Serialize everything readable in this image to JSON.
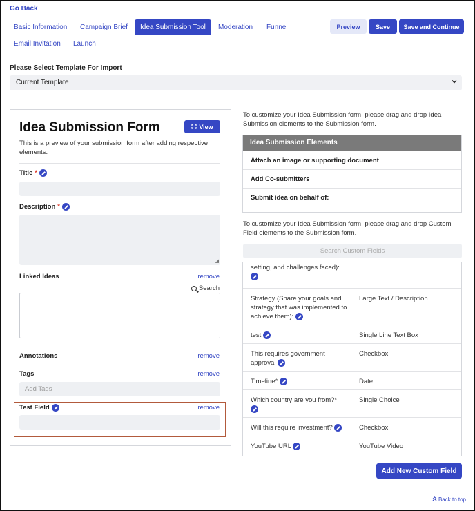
{
  "nav": {
    "go_back": "Go Back",
    "tabs": [
      {
        "label": "Basic Information"
      },
      {
        "label": "Campaign Brief"
      },
      {
        "label": "Idea Submission Tool"
      },
      {
        "label": "Moderation"
      },
      {
        "label": "Funnel"
      },
      {
        "label": "Email Invitation"
      },
      {
        "label": "Launch"
      }
    ],
    "active_tab": "Idea Submission Tool"
  },
  "actions": {
    "preview": "Preview",
    "save": "Save",
    "save_continue": "Save and Continue"
  },
  "template": {
    "label": "Please Select Template For Import",
    "selected": "Current Template"
  },
  "form": {
    "title": "Idea Submission Form",
    "view_label": "View",
    "description": "This is a preview of your submission form after adding respective elements.",
    "fields": {
      "title": "Title",
      "description": "Description",
      "linked_ideas": "Linked Ideas",
      "annotations": "Annotations",
      "tags": "Tags",
      "tags_placeholder": "Add Tags",
      "test_field": "Test Field"
    },
    "remove": "remove",
    "search": "Search",
    "required_mark": "*"
  },
  "elements": {
    "instruction": "To customize your Idea Submission form, please drag and drop Idea Submission elements to the Submission form.",
    "header": "Idea Submission Elements",
    "items": [
      "Attach an image or supporting document",
      "Add Co-submitters",
      "Submit idea on behalf of:"
    ]
  },
  "custom_fields": {
    "instruction": "To customize your Idea Submission form, please drag and drop Custom Field elements to the Submission form.",
    "search_placeholder": "Search Custom Fields",
    "rows": [
      {
        "name": "setting, and challenges faced):",
        "type": ""
      },
      {
        "name": "Strategy (Share your goals and strategy that was implemented to achieve them):",
        "type": "Large Text / Description"
      },
      {
        "name": "test",
        "type": "Single Line Text Box"
      },
      {
        "name": "This requires government approval",
        "type": "Checkbox"
      },
      {
        "name": "Timeline*",
        "type": "Date"
      },
      {
        "name": "Which country are you from?*",
        "type": "Single Choice"
      },
      {
        "name": "Will this require investment?",
        "type": "Checkbox"
      },
      {
        "name": "YouTube URL",
        "type": "YouTube Video"
      }
    ],
    "add_button": "Add New Custom Field"
  },
  "footer": {
    "back_to_top": "Back to top"
  },
  "colors": {
    "accent": "#3547c4",
    "header_gray": "#7a7a7a",
    "highlight_border": "#b25a3c"
  }
}
